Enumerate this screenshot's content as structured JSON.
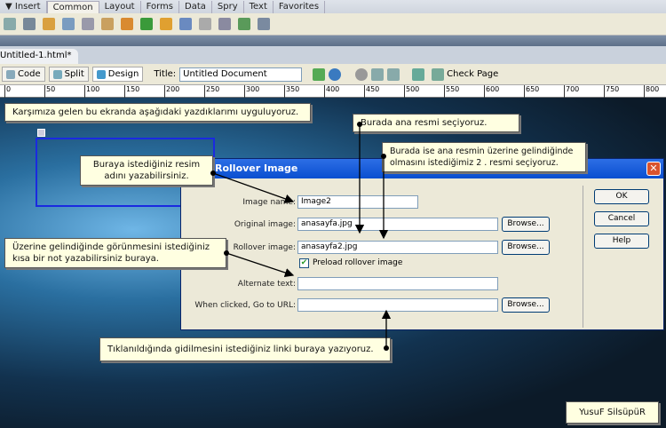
{
  "insert_bar": {
    "menu": "▼ Insert",
    "tabs": [
      "Common",
      "Layout",
      "Forms",
      "Data",
      "Spry",
      "Text",
      "Favorites"
    ]
  },
  "document": {
    "tab": "Untitled-1.html*",
    "code": "Code",
    "split": "Split",
    "design": "Design",
    "title_label": "Title:",
    "title_value": "Untitled Document",
    "check_page": "Check Page"
  },
  "ruler": [
    "0",
    "50",
    "100",
    "150",
    "200",
    "250",
    "300",
    "350",
    "400",
    "450",
    "500",
    "550",
    "600",
    "650",
    "700",
    "750",
    "800"
  ],
  "dialog": {
    "title": "Rollover Image",
    "fields": [
      {
        "label": "Image name:",
        "value": ""
      },
      {
        "label": "Original image:",
        "value": "anasayfa.jpg"
      },
      {
        "label": "Rollover image:",
        "value": "anasayfa2.jpg"
      }
    ],
    "image_name": "Image2",
    "preload": "Preload rollover image",
    "preload_checked": true,
    "alt_label": "Alternate text:",
    "url_label": "When clicked, Go to URL:",
    "browse": "Browse...",
    "ok": "OK",
    "cancel": "Cancel",
    "help": "Help"
  },
  "callouts": {
    "c1": "Karşımıza gelen bu ekranda aşağıdaki yazdıklarımı uyguluyoruz.",
    "c2": "Burada ana resmi seçiyoruz.",
    "c3": "Burada ise ana resmin üzerine gelindiğinde olmasını istediğimiz 2 . resmi seçiyoruz.",
    "c4": "Buraya istediğiniz resim adını yazabilirsiniz.",
    "c5": "Üzerine gelindiğinde görünmesini istediğiniz kısa bir not yazabilirsiniz buraya.",
    "c6": "Tıklanıldığında gidilmesini istediğiniz linki buraya yazıyoruz.",
    "c7": "YusuF SilsüpüR"
  }
}
